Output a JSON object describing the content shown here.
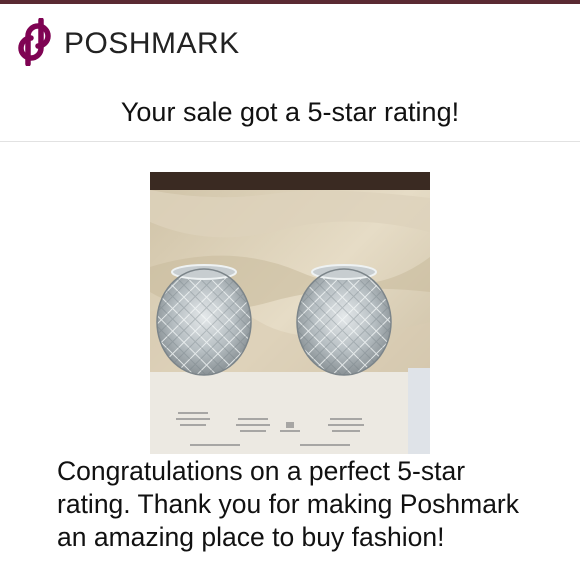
{
  "brand": {
    "name": "POSHMARK",
    "color": "#7f0353",
    "logo_icon": "poshmark-logo-icon"
  },
  "email": {
    "subject": "Your sale got a 5-star rating!",
    "message": "Congratulations on a perfect 5-star rating. Thank you for making Poshmark an amazing place to buy fashion!"
  },
  "product": {
    "image": "product-photo-glass-candle-holders"
  },
  "colors": {
    "top_bar": "#5a2a32",
    "divider": "#e2e2e2"
  }
}
